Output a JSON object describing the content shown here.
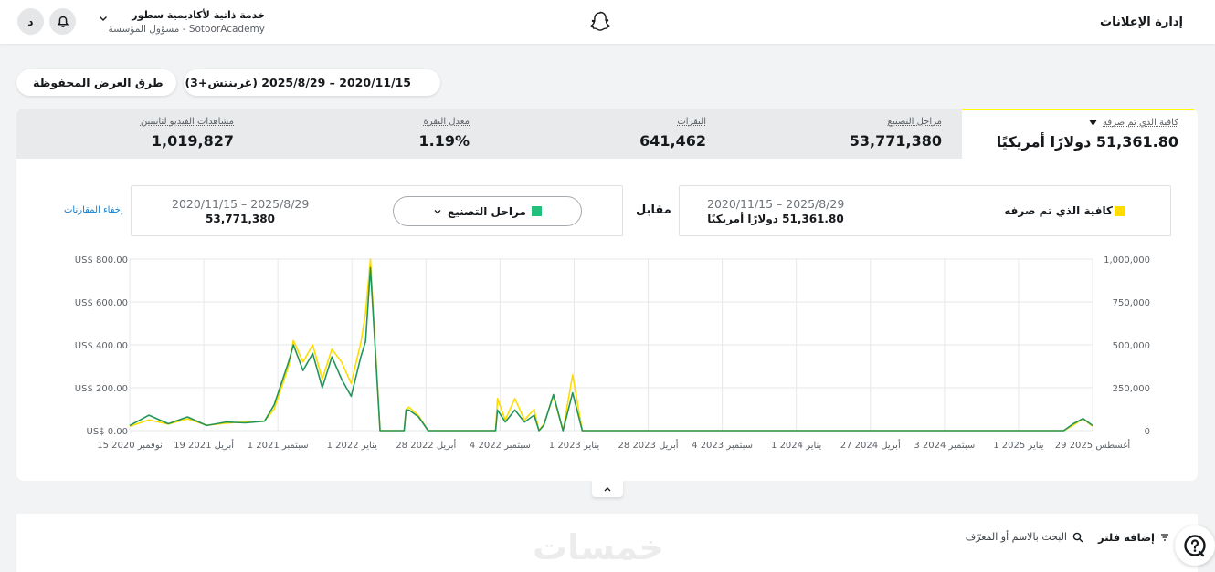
{
  "header": {
    "avatar_letter": "د",
    "account_name": "خدمة ذاتية لأكاديمية سطور",
    "account_subtitle": "SotoorAcademy - مسؤول المؤسسة",
    "ads_manager_label": "إدارة الإعلانات"
  },
  "toolbar": {
    "saved_views_label": "طرق العرض المحفوظة",
    "date_range_label": "2020/11/15 – 2025/8/29 (غرينتش+3)"
  },
  "stats": {
    "selected": {
      "label": "كافية الذي تم صرفه",
      "value": "51,361.80 دولارًا أمريكيًا"
    },
    "items": [
      {
        "label": "مراحل التصنيع",
        "value": "53,771,380"
      },
      {
        "label": "النقرات",
        "value": "641,462"
      },
      {
        "label": "معدل النقرة",
        "value": "1.19%"
      },
      {
        "label": "مشاهدات الفيديو لثانيتين",
        "value": "1,019,827"
      }
    ]
  },
  "comparison": {
    "hide_label": "إخفاء المقارنات",
    "versus_label": "مقابل",
    "left": {
      "dates": "2020/11/15 – 2025/8/29",
      "value": "53,771,380",
      "metric": "مراحل التصنيع"
    },
    "right": {
      "dates": "2020/11/15 – 2025/8/29",
      "value": "51,361.80 دولارًا أمريكيًا",
      "metric": "كافية الذي تم صرفه"
    }
  },
  "colors": {
    "spend": "#fedc00",
    "impressions": "#23945a",
    "accent": "#fffc00",
    "link": "#0b7ed0"
  },
  "chart_data": {
    "type": "line",
    "x_tick_labels": [
      "15 نوفمبر 2020",
      "19 أبريل 2021",
      "1 سبتمبر 2021",
      "1 يناير 2022",
      "28 أبريل 2022",
      "4 سبتمبر 2022",
      "1 يناير 2023",
      "28 أبريل 2023",
      "4 سبتمبر 2023",
      "1 يناير 2024",
      "27 أبريل 2024",
      "3 سبتمبر 2024",
      "1 يناير 2025",
      "29 أغسطس 2025"
    ],
    "y_left_tick_labels": [
      "US$ 0.00",
      "US$ 200.00",
      "US$ 400.00",
      "US$ 600.00",
      "US$ 800.00"
    ],
    "y_right_tick_labels": [
      "0",
      "250,000",
      "500,000",
      "750,000",
      "1,000,000"
    ],
    "y_left_range": [
      0,
      800
    ],
    "y_right_range": [
      0,
      1000000
    ],
    "grid": true,
    "series": [
      {
        "name": "كافية الذي تم صرفه",
        "axis": "left",
        "x": [
          0,
          0.02,
          0.04,
          0.06,
          0.08,
          0.1,
          0.12,
          0.14,
          0.15,
          0.165,
          0.17,
          0.18,
          0.19,
          0.2,
          0.21,
          0.22,
          0.23,
          0.24,
          0.245,
          0.25,
          0.26,
          0.27,
          0.28,
          0.285,
          0.287,
          0.29,
          0.3,
          0.31,
          0.35,
          0.38,
          0.382,
          0.39,
          0.4,
          0.41,
          0.42,
          0.425,
          0.43,
          0.44,
          0.45,
          0.46,
          0.47,
          0.48,
          0.485,
          0.487,
          0.49,
          0.495,
          0.5,
          0.505,
          0.507,
          0.51,
          0.52,
          0.53,
          0.55,
          0.6,
          0.7,
          0.8,
          0.85,
          0.86,
          0.87,
          0.88,
          0.9,
          0.93,
          0.95,
          0.97,
          0.98,
          0.99,
          1
        ],
        "values": [
          20,
          50,
          30,
          55,
          25,
          35,
          40,
          45,
          100,
          300,
          420,
          320,
          400,
          240,
          380,
          320,
          220,
          410,
          550,
          800,
          0,
          0,
          0,
          0,
          100,
          110,
          70,
          0,
          0,
          0,
          150,
          50,
          150,
          50,
          100,
          0,
          30,
          160,
          0,
          260,
          0,
          0,
          0,
          0,
          0,
          0,
          0,
          0,
          0,
          0,
          0,
          0,
          0,
          0,
          0,
          0,
          0,
          0,
          0,
          0,
          0,
          0,
          0,
          0,
          25,
          55,
          20
        ]
      },
      {
        "name": "مراحل التصنيع",
        "axis": "right",
        "x": [
          0,
          0.02,
          0.04,
          0.06,
          0.08,
          0.1,
          0.12,
          0.14,
          0.15,
          0.165,
          0.17,
          0.18,
          0.19,
          0.2,
          0.21,
          0.22,
          0.23,
          0.24,
          0.245,
          0.25,
          0.26,
          0.27,
          0.28,
          0.285,
          0.287,
          0.29,
          0.3,
          0.31,
          0.35,
          0.38,
          0.382,
          0.39,
          0.4,
          0.41,
          0.42,
          0.425,
          0.43,
          0.44,
          0.45,
          0.46,
          0.47,
          0.48,
          0.485,
          0.487,
          0.49,
          0.495,
          0.5,
          0.505,
          0.507,
          0.51,
          0.52,
          0.53,
          0.55,
          0.6,
          0.7,
          0.8,
          0.85,
          0.86,
          0.87,
          0.88,
          0.9,
          0.93,
          0.95,
          0.97,
          0.98,
          0.99,
          1
        ],
        "values": [
          30000,
          90000,
          40000,
          80000,
          30000,
          50000,
          45000,
          55000,
          150000,
          400000,
          500000,
          350000,
          450000,
          250000,
          430000,
          300000,
          200000,
          430000,
          520000,
          950000,
          0,
          0,
          0,
          0,
          120000,
          120000,
          80000,
          0,
          0,
          0,
          120000,
          50000,
          120000,
          50000,
          90000,
          0,
          30000,
          210000,
          0,
          220000,
          0,
          0,
          0,
          0,
          0,
          0,
          0,
          0,
          0,
          0,
          0,
          0,
          0,
          0,
          0,
          0,
          0,
          0,
          0,
          0,
          0,
          0,
          0,
          0,
          40000,
          70000,
          30000
        ]
      }
    ]
  },
  "filters": {
    "add_filter_label": "إضافة فلتر",
    "search_placeholder": "البحث بالاسم أو المعرّف"
  },
  "watermark": "خمسات"
}
